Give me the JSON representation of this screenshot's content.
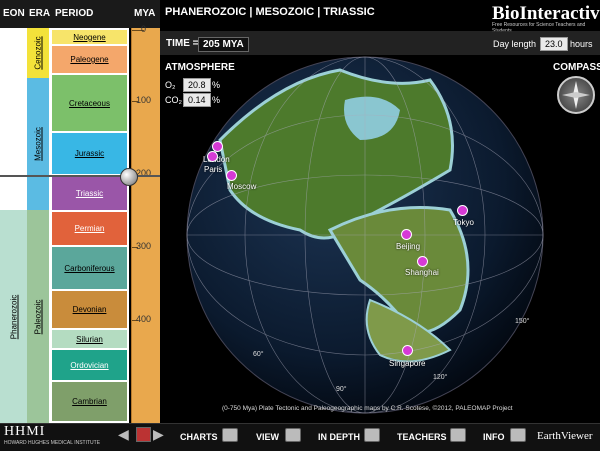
{
  "timeline": {
    "headers": {
      "eon": "EON",
      "era": "ERA",
      "period": "PERIOD",
      "mya": "MYA"
    },
    "eons": [
      {
        "label": "Phanerozoic"
      }
    ],
    "eras": [
      {
        "label": "Cenozoic",
        "color": "#f3e23a"
      },
      {
        "label": "Mesozoic",
        "color": "#5bbbe3"
      },
      {
        "label": "Paleozoic",
        "color": "#9cc59a"
      }
    ],
    "periods": [
      {
        "label": "Neogene",
        "color": "#f7e46a"
      },
      {
        "label": "Paleogene",
        "color": "#f4a76b"
      },
      {
        "label": "Cretaceous",
        "color": "#7cc06a"
      },
      {
        "label": "Jurassic",
        "color": "#38b7e5"
      },
      {
        "label": "Triassic",
        "color": "#9a56a8"
      },
      {
        "label": "Permian",
        "color": "#e1623b"
      },
      {
        "label": "Carboniferous",
        "color": "#5ba79b"
      },
      {
        "label": "Devonian",
        "color": "#c98c3b"
      },
      {
        "label": "Silurian",
        "color": "#b4dcc1"
      },
      {
        "label": "Ordovician",
        "color": "#1fa38a"
      },
      {
        "label": "Cambrian",
        "color": "#7f9f6a"
      }
    ],
    "ticks": [
      "0",
      "100",
      "200",
      "300",
      "400"
    ],
    "selected_mya": 205
  },
  "header": {
    "title": "PHANEROZOIC | MESOZOIC | TRIASSIC",
    "logo": "BioInteractive",
    "logo_sub": "Free Resources for Science Teachers and Students"
  },
  "controls": {
    "time_label": "TIME =",
    "time_value": "205 MYA",
    "day_length_label": "Day length",
    "day_length_value": "23.0",
    "day_length_unit": "hours",
    "atmosphere_label": "ATMOSPHERE",
    "o2_label": "O₂",
    "o2_value": "20.8",
    "co2_label": "CO₂",
    "co2_value": "0.14",
    "percent": "%",
    "compass_label": "COMPASS"
  },
  "cities": [
    {
      "name": "London"
    },
    {
      "name": "Paris"
    },
    {
      "name": "Moscow"
    },
    {
      "name": "Beijing"
    },
    {
      "name": "Shanghai"
    },
    {
      "name": "Tokyo"
    },
    {
      "name": "Singapore"
    }
  ],
  "longitudes": [
    "60°",
    "90°",
    "120°",
    "150°"
  ],
  "credit": "(0-750 Mya) Plate Tectonic and Paleogeographic maps by C.R. Scotese, ©2012, PALEOMAP Project",
  "footer": {
    "hhmi": "HHMI",
    "hhmi_sub": "HOWARD HUGHES MEDICAL INSTITUTE",
    "nav": {
      "charts": "CHARTS",
      "view": "VIEW",
      "in_depth": "IN DEPTH",
      "teachers": "TEACHERS",
      "info": "INFO"
    },
    "app_name": "EarthViewer"
  }
}
